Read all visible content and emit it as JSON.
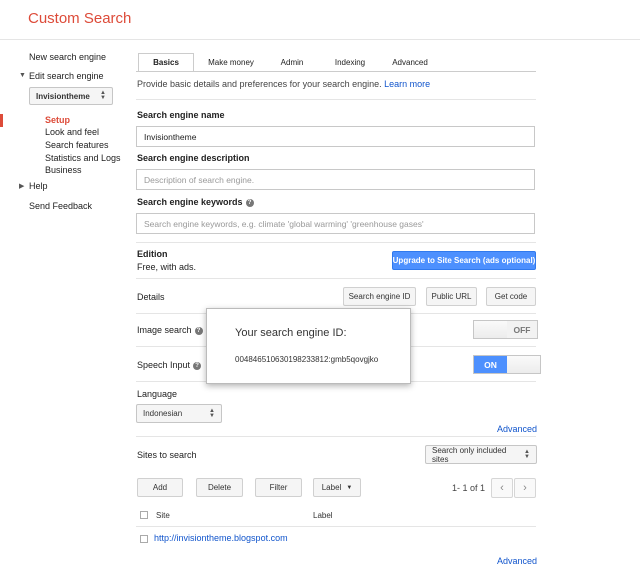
{
  "app": {
    "title": "Custom Search"
  },
  "sidebar": {
    "new_engine": "New search engine",
    "edit_engine": "Edit search engine",
    "engine_select": "Invisiontheme",
    "sub_items": [
      "Setup",
      "Look and feel",
      "Search features",
      "Statistics and Logs",
      "Business"
    ],
    "help": "Help",
    "feedback": "Send Feedback"
  },
  "tabs": [
    "Basics",
    "Make money",
    "Admin",
    "Indexing",
    "Advanced"
  ],
  "intro": {
    "text": "Provide basic details and preferences for your search engine.",
    "link": "Learn more"
  },
  "fields": {
    "name_label": "Search engine name",
    "name_value": "Invisiontheme",
    "description_label": "Search engine description",
    "description_placeholder": "Description of search engine.",
    "keywords_label": "Search engine keywords",
    "keywords_placeholder": "Search engine keywords, e.g. climate 'global warming' 'greenhouse gases'"
  },
  "edition": {
    "label": "Edition",
    "value": "Free, with ads.",
    "upgrade_button": "Upgrade to Site Search (ads optional)"
  },
  "details": {
    "label": "Details",
    "buttons": [
      "Search engine ID",
      "Public URL",
      "Get code"
    ]
  },
  "image_search": {
    "label": "Image search",
    "state": "OFF"
  },
  "speech_input": {
    "label": "Speech Input",
    "state": "ON"
  },
  "language": {
    "label": "Language",
    "value": "Indonesian"
  },
  "advanced_link": "Advanced",
  "sites": {
    "label": "Sites to search",
    "scope_select": "Search only included sites",
    "buttons": {
      "add": "Add",
      "delete": "Delete",
      "filter": "Filter",
      "label": "Label"
    },
    "pager": "1- 1 of 1",
    "columns": {
      "site": "Site",
      "label": "Label"
    },
    "rows": [
      {
        "site": "http://invisiontheme.blogspot.com",
        "label": ""
      }
    ],
    "advanced_link": "Advanced"
  },
  "popup": {
    "title": "Your search engine ID:",
    "id": "004846510630198233812:gmb5qovgjko"
  },
  "colors": {
    "brand_red": "#dd4b39",
    "link_blue": "#1155cc",
    "button_blue": "#4d90fe"
  }
}
